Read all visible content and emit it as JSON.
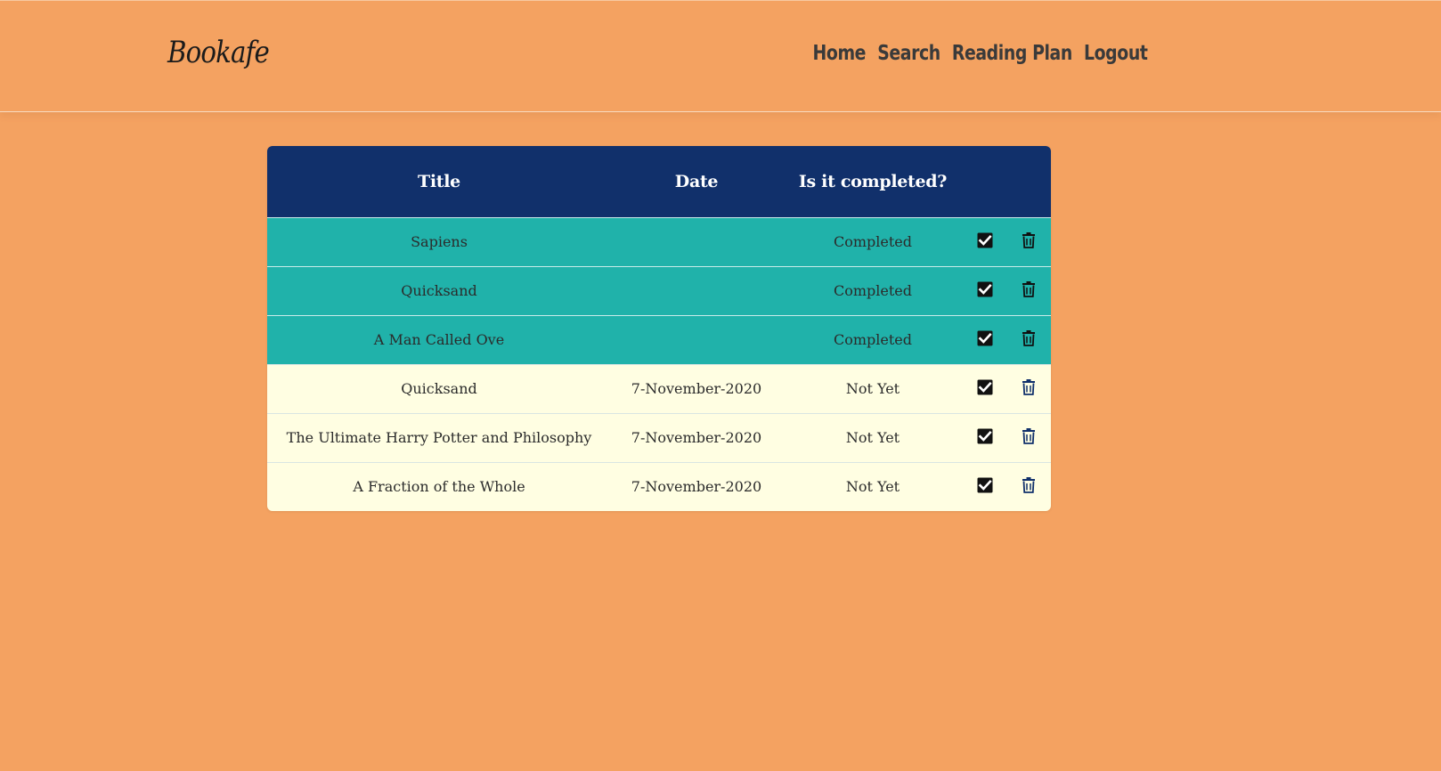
{
  "header": {
    "brand": "Bookafe",
    "nav": [
      "Home",
      "Search",
      "Reading Plan",
      "Logout"
    ]
  },
  "table": {
    "columns": {
      "title": "Title",
      "date": "Date",
      "status": "Is it completed?"
    },
    "rows": [
      {
        "title": "Sapiens",
        "date": "",
        "status": "Completed",
        "completed": true
      },
      {
        "title": "Quicksand",
        "date": "",
        "status": "Completed",
        "completed": true
      },
      {
        "title": "A Man Called Ove",
        "date": "",
        "status": "Completed",
        "completed": true
      },
      {
        "title": "Quicksand",
        "date": "7-November-2020",
        "status": "Not Yet",
        "completed": false
      },
      {
        "title": "The Ultimate Harry Potter and Philosophy",
        "date": "7-November-2020",
        "status": "Not Yet",
        "completed": false
      },
      {
        "title": "A Fraction of the Whole",
        "date": "7-November-2020",
        "status": "Not Yet",
        "completed": false
      }
    ]
  },
  "colors": {
    "background": "#f4a261",
    "table_header": "#11306b",
    "row_completed": "#20b2aa",
    "row_pending": "#fffee2"
  },
  "icons": {
    "row_actions": [
      "check-square-icon",
      "trash-icon"
    ]
  }
}
